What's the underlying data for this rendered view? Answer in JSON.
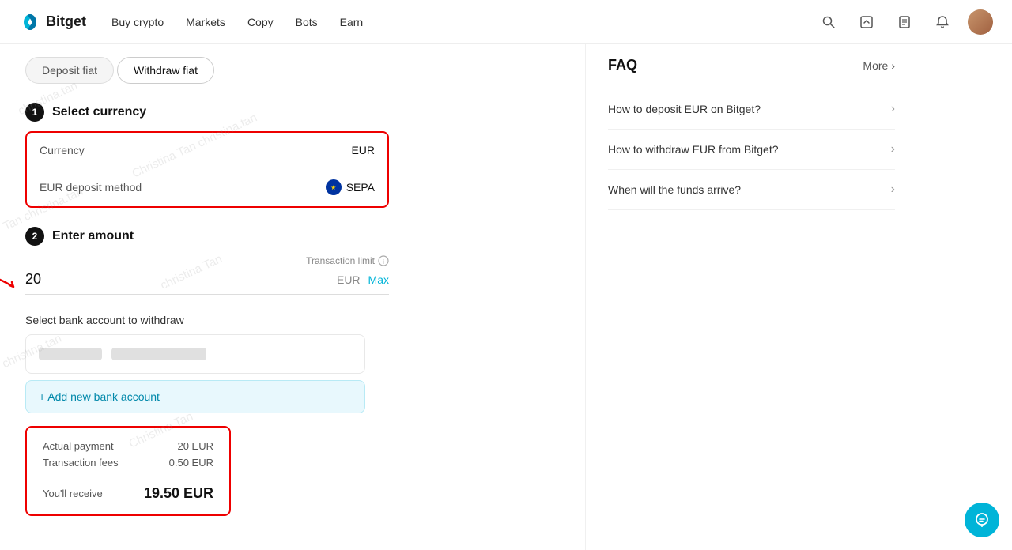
{
  "brand": {
    "name": "Bitget"
  },
  "nav": {
    "links": [
      "Buy crypto",
      "Markets",
      "Copy",
      "Bots",
      "Earn"
    ]
  },
  "tabs": [
    {
      "id": "deposit",
      "label": "Deposit fiat",
      "active": false
    },
    {
      "id": "withdraw",
      "label": "Withdraw fiat",
      "active": true
    }
  ],
  "steps": {
    "step1": {
      "number": "1",
      "title": "Select currency",
      "currency_label": "Currency",
      "currency_value": "EUR",
      "method_label": "EUR deposit method",
      "method_value": "SEPA"
    },
    "step2": {
      "number": "2",
      "title": "Enter amount",
      "tx_limit_label": "Transaction limit",
      "amount": "20",
      "currency": "EUR",
      "max_label": "Max"
    }
  },
  "bank_section": {
    "title": "Select bank account to withdraw",
    "add_label": "+ Add new bank account"
  },
  "payment_summary": {
    "actual_payment_label": "Actual payment",
    "actual_payment_value": "20 EUR",
    "fees_label": "Transaction fees",
    "fees_value": "0.50 EUR",
    "receive_label": "You'll receive",
    "receive_value": "19.50 EUR"
  },
  "faq": {
    "title": "FAQ",
    "more_label": "More",
    "items": [
      {
        "text": "How to deposit EUR on Bitget?"
      },
      {
        "text": "How to withdraw EUR from Bitget?"
      },
      {
        "text": "When will the funds arrive?"
      }
    ]
  },
  "icons": {
    "search": "🔍",
    "transfer": "⬆",
    "history": "📋",
    "bell": "🔔",
    "chevron_right": "›",
    "headset": "🎧",
    "info": "ℹ"
  }
}
